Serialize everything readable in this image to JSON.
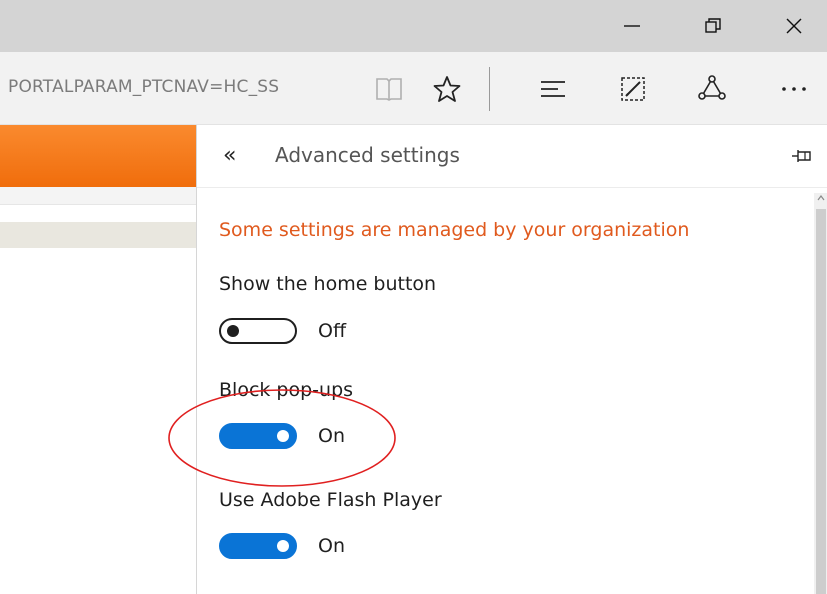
{
  "window": {
    "controls": {
      "minimize_icon": "minimize-icon",
      "restore_icon": "restore-icon",
      "close_icon": "close-icon"
    }
  },
  "toolbar": {
    "url_text": "PORTALPARAM_PTCNAV=HC_SS",
    "icons": [
      "reading-view-icon",
      "favorite-star-icon",
      "hub-icon",
      "web-note-icon",
      "share-icon",
      "more-actions-icon"
    ]
  },
  "panel": {
    "title": "Advanced settings",
    "back_icon": "double-chevron-left-icon",
    "pin_icon": "pin-icon",
    "managed_note": "Some settings are managed by your organization",
    "settings": [
      {
        "label": "Show the home button",
        "state": "Off",
        "on": false
      },
      {
        "label": "Block pop-ups",
        "state": "On",
        "on": true
      },
      {
        "label": "Use Adobe Flash Player",
        "state": "On",
        "on": true
      }
    ]
  },
  "colors": {
    "accent_blue": "#0a74d6",
    "warning_orange": "#e05a1e",
    "page_header_orange": "#f47b1f",
    "annotation_red": "#e02020"
  }
}
